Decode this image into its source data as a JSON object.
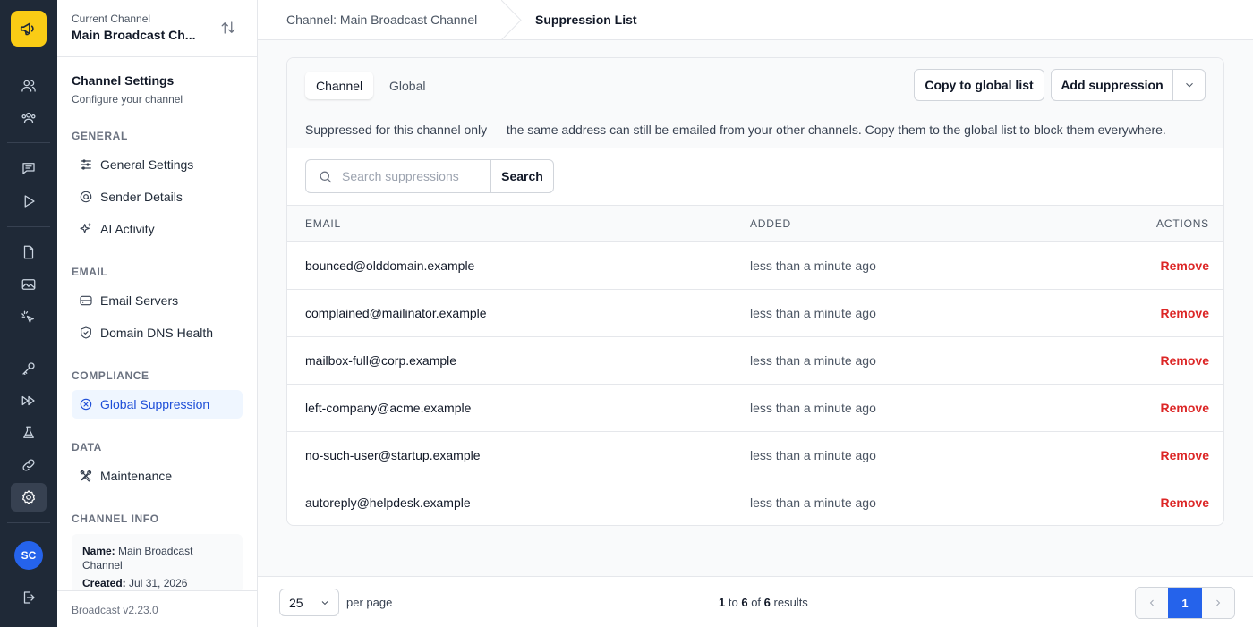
{
  "channel_switcher": {
    "label": "Current Channel",
    "name": "Main Broadcast Ch..."
  },
  "sidebar": {
    "title": "Channel Settings",
    "subtitle": "Configure your channel",
    "sections": {
      "general": "GENERAL",
      "email": "EMAIL",
      "compliance": "COMPLIANCE",
      "data": "DATA",
      "channel_info": "CHANNEL INFO"
    },
    "items": {
      "general_settings": "General Settings",
      "sender_details": "Sender Details",
      "ai_activity": "AI Activity",
      "email_servers": "Email Servers",
      "domain_dns_health": "Domain DNS Health",
      "global_suppression": "Global Suppression",
      "maintenance": "Maintenance"
    },
    "channel_info": {
      "name_label": "Name:",
      "name_value": "Main Broadcast Channel",
      "created_label": "Created:",
      "created_value": "Jul 31, 2026"
    },
    "version": "Broadcast v2.23.0"
  },
  "user": {
    "initials": "SC"
  },
  "breadcrumb": {
    "parent": "Channel: Main Broadcast Channel",
    "current": "Suppression List"
  },
  "tabs": {
    "channel": "Channel",
    "global": "Global"
  },
  "actions": {
    "copy_to_global": "Copy to global list",
    "add_suppression": "Add suppression"
  },
  "description": "Suppressed for this channel only — the same address can still be emailed from your other channels. Copy them to the global list to block them everywhere.",
  "search": {
    "placeholder": "Search suppressions",
    "button": "Search"
  },
  "table": {
    "columns": {
      "email": "EMAIL",
      "added": "ADDED",
      "actions": "ACTIONS"
    },
    "rows": [
      {
        "email": "bounced@olddomain.example",
        "added": "less than a minute ago",
        "action": "Remove"
      },
      {
        "email": "complained@mailinator.example",
        "added": "less than a minute ago",
        "action": "Remove"
      },
      {
        "email": "mailbox-full@corp.example",
        "added": "less than a minute ago",
        "action": "Remove"
      },
      {
        "email": "left-company@acme.example",
        "added": "less than a minute ago",
        "action": "Remove"
      },
      {
        "email": "no-such-user@startup.example",
        "added": "less than a minute ago",
        "action": "Remove"
      },
      {
        "email": "autoreply@helpdesk.example",
        "added": "less than a minute ago",
        "action": "Remove"
      }
    ]
  },
  "pagination": {
    "per_page": "25",
    "per_page_label": "per page",
    "from": "1",
    "to_word": "to",
    "to": "6",
    "of_word": "of",
    "total": "6",
    "results_word": "results",
    "current_page": "1"
  },
  "colors": {
    "brand": "#facc15",
    "accent": "#2563eb",
    "danger": "#dc2626",
    "rail": "#1f2937"
  }
}
